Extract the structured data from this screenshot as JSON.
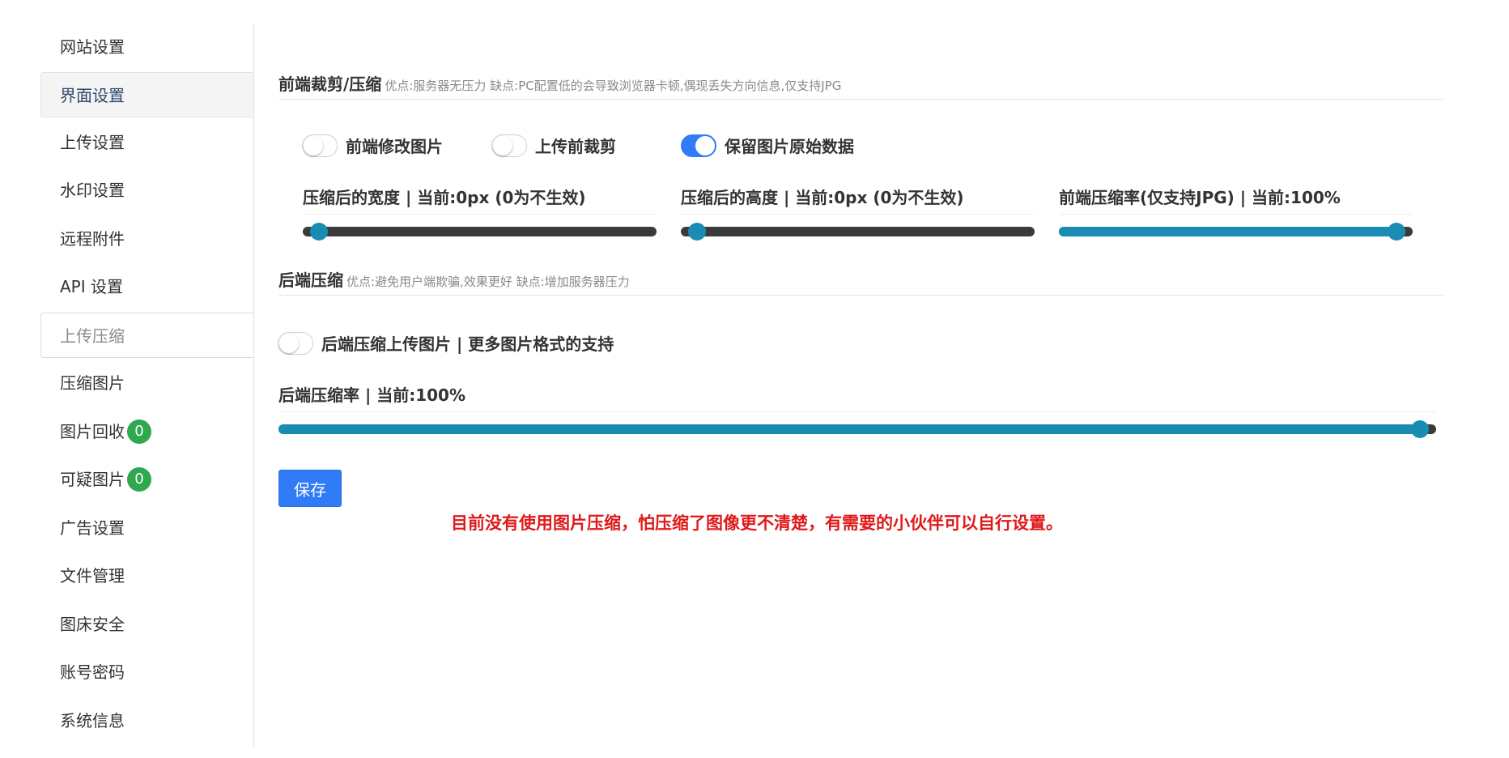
{
  "sidebar": {
    "items": [
      {
        "label": "网站设置"
      },
      {
        "label": "界面设置"
      },
      {
        "label": "上传设置"
      },
      {
        "label": "水印设置"
      },
      {
        "label": "远程附件"
      },
      {
        "label": "API 设置"
      },
      {
        "label": "上传压缩"
      },
      {
        "label": "压缩图片"
      },
      {
        "label": "图片回收",
        "badge": "0"
      },
      {
        "label": "可疑图片",
        "badge": "0"
      },
      {
        "label": "广告设置"
      },
      {
        "label": "文件管理"
      },
      {
        "label": "图床安全"
      },
      {
        "label": "账号密码"
      },
      {
        "label": "系统信息"
      }
    ]
  },
  "frontend": {
    "title": "前端裁剪/压缩",
    "hint": "优点:服务器无压力 缺点:PC配置低的会导致浏览器卡顿,偶现丢失方向信息,仅支持JPG",
    "switches": [
      {
        "label": "前端修改图片",
        "on": false
      },
      {
        "label": "上传前裁剪",
        "on": false
      },
      {
        "label": "保留图片原始数据",
        "on": true
      }
    ],
    "sliders": [
      {
        "label": "压缩后的宽度 | 当前:0px (0为不生效)",
        "fraction": 0.0
      },
      {
        "label": "压缩后的高度 | 当前:0px (0为不生效)",
        "fraction": 0.0
      },
      {
        "label": "前端压缩率(仅支持JPG) | 当前:100%",
        "fraction": 1.0
      }
    ]
  },
  "backend": {
    "title": "后端压缩",
    "hint": "优点:避免用户端欺骗,效果更好 缺点:增加服务器压力",
    "switch": {
      "label": "后端压缩上传图片 | 更多图片格式的支持",
      "on": false
    },
    "slider": {
      "label": "后端压缩率 | 当前:100%",
      "fraction": 1.0
    }
  },
  "save_label": "保存",
  "note": "目前没有使用图片压缩，怕压缩了图像更不清楚，有需要的小伙伴可以自行设置。",
  "colors": {
    "accent": "#2f7cf6",
    "slider": "#1a8cb3",
    "badge": "#2fa84f",
    "note": "#e0191a"
  }
}
